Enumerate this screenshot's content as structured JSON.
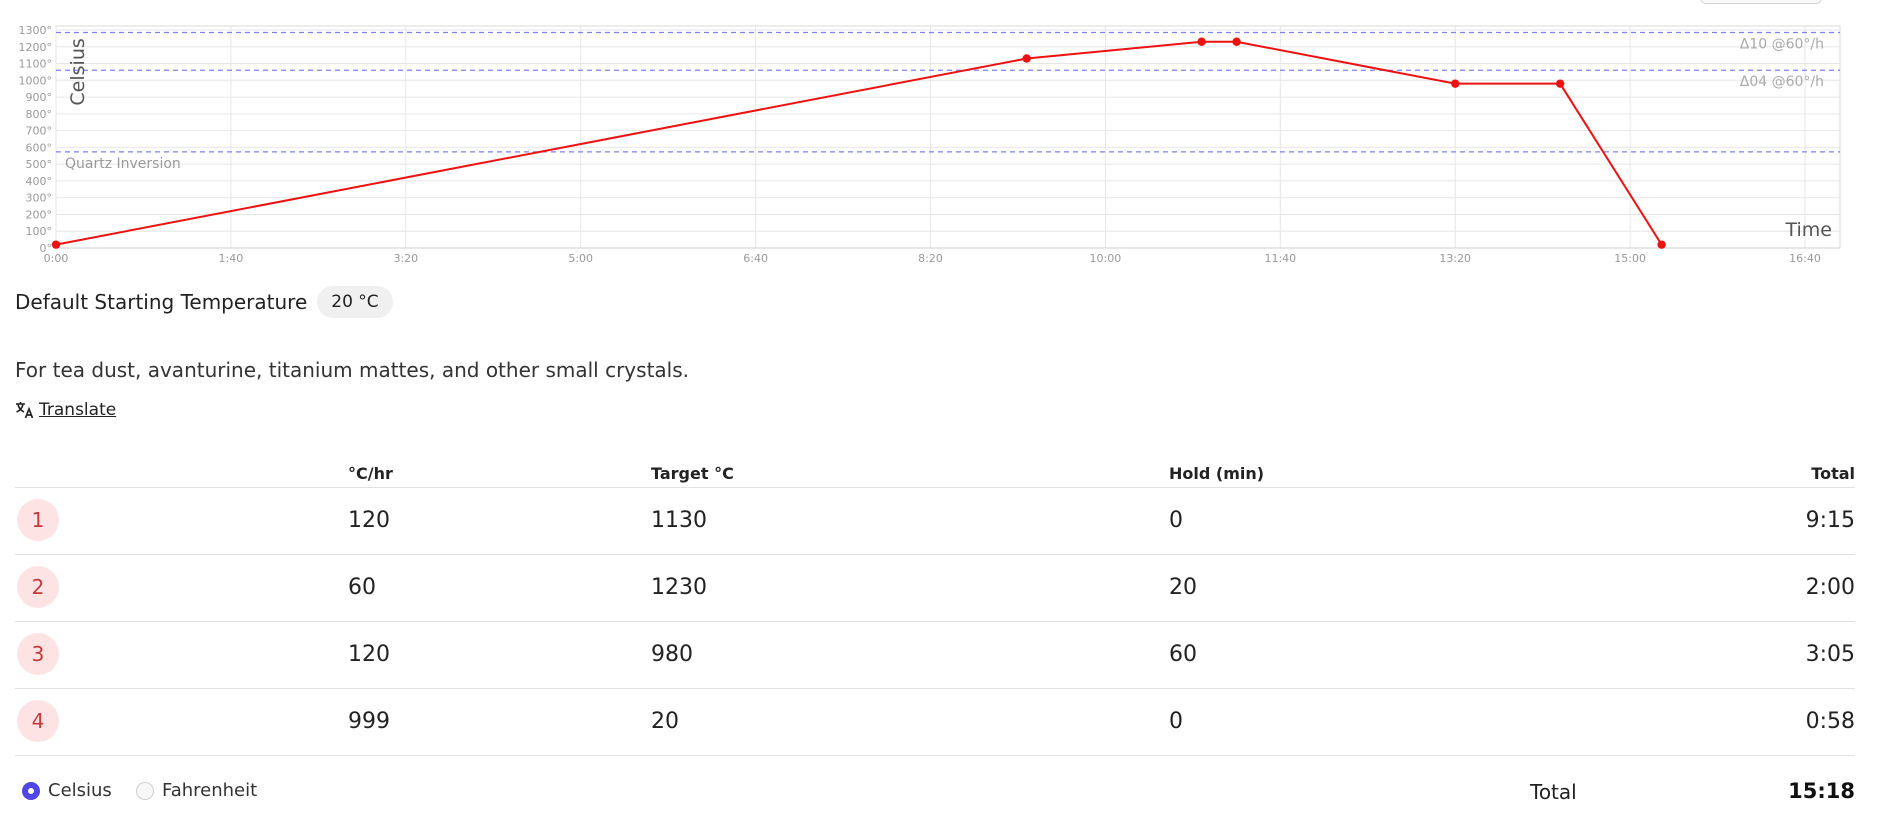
{
  "chart_data": {
    "type": "line",
    "ylabel": "Celsius",
    "xlabel": "Time",
    "ylim": [
      0,
      1300
    ],
    "xlim_minutes": [
      0,
      1020
    ],
    "y_ticks": [
      "0°",
      "100°",
      "200°",
      "300°",
      "400°",
      "500°",
      "600°",
      "700°",
      "800°",
      "900°",
      "1000°",
      "1100°",
      "1200°",
      "1300°"
    ],
    "x_ticks": [
      "0:00",
      "1:40",
      "3:20",
      "5:00",
      "6:40",
      "8:20",
      "10:00",
      "11:40",
      "13:20",
      "15:00",
      "16:40"
    ],
    "grid": true,
    "series": [
      {
        "color": "#ee1111",
        "points": [
          {
            "t": "0:00",
            "c": 20
          },
          {
            "t": "9:15",
            "c": 1130
          },
          {
            "t": "10:55",
            "c": 1230
          },
          {
            "t": "11:15",
            "c": 1230
          },
          {
            "t": "13:20",
            "c": 980
          },
          {
            "t": "14:20",
            "c": 980
          },
          {
            "t": "15:18",
            "c": 20
          }
        ]
      }
    ],
    "reference_lines": [
      {
        "c": 1285,
        "label": "",
        "side": "right"
      },
      {
        "c": 1060,
        "label": "",
        "side": "right"
      },
      {
        "c": 573,
        "label": "Quartz Inversion",
        "side": "left"
      }
    ],
    "annotations": [
      {
        "text": "Δ10 @60°/h",
        "near_c": 1285
      },
      {
        "text": "Δ04 @60°/h",
        "near_c": 1060
      }
    ]
  },
  "start_temp": {
    "label": "Default Starting Temperature",
    "value": "20 °C"
  },
  "description": "For tea dust, avanturine, titanium mattes, and other small crystals.",
  "translate_label": " Translate",
  "table": {
    "headers": {
      "rate": "°C/hr",
      "target": "Target °C",
      "hold": "Hold (min)",
      "total": "Total"
    },
    "rows": [
      {
        "n": "1",
        "rate": "120",
        "target": "1130",
        "hold": "0",
        "total": "9:15"
      },
      {
        "n": "2",
        "rate": "60",
        "target": "1230",
        "hold": "20",
        "total": "2:00"
      },
      {
        "n": "3",
        "rate": "120",
        "target": "980",
        "hold": "60",
        "total": "3:05"
      },
      {
        "n": "4",
        "rate": "999",
        "target": "20",
        "hold": "0",
        "total": "0:58"
      }
    ]
  },
  "units": {
    "celsius": "Celsius",
    "fahrenheit": "Fahrenheit",
    "selected": "celsius"
  },
  "footer": {
    "total_label": "Total",
    "total_value": "15:18"
  }
}
